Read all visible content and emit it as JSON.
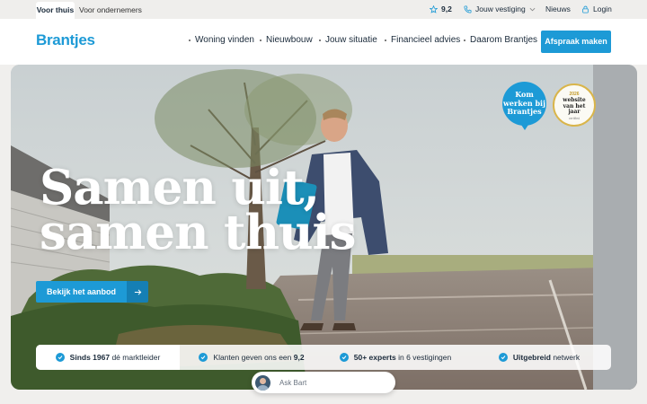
{
  "topbar": {
    "tab_active": "Voor thuis",
    "tab_inactive": "Voor ondernemers",
    "rating": "9,2",
    "vestiging": "Jouw vestiging",
    "nieuws": "Nieuws",
    "login": "Login"
  },
  "header": {
    "logo": "Brantjes",
    "nav": [
      "Woning vinden",
      "Nieuwbouw",
      "Jouw situatie",
      "Financieel advies",
      "Daarom Brantjes"
    ],
    "cta": "Afspraak maken"
  },
  "hero": {
    "headline_line1": "Samen uit,",
    "headline_line2": "samen thuis",
    "button": "Bekijk het aanbod",
    "badge_work": [
      "Kom",
      "werken bij",
      "Brantjes"
    ],
    "award_year": "2026",
    "award_text": [
      "website",
      "van het",
      "jaar"
    ],
    "award_sub": "certified"
  },
  "usps": [
    {
      "bold": "Sinds 1967",
      "rest": " dé marktleider"
    },
    {
      "pre": "Klanten geven ons een ",
      "bold": "9,2"
    },
    {
      "bold": "50+ experts",
      "rest": " in 6 vestigingen"
    },
    {
      "bold": "Uitgebreid",
      "rest": " netwerk"
    }
  ],
  "assistant": {
    "label": "Ask Bart"
  },
  "colors": {
    "brand": "#1d9ad6",
    "brand_dark": "#157fb4"
  }
}
